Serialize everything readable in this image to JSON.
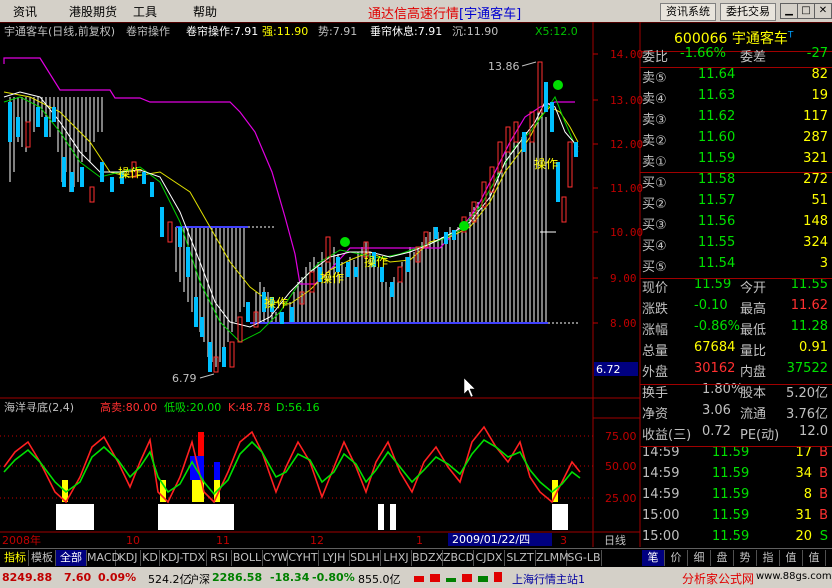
{
  "menu": [
    "资讯",
    "港股期货",
    "工具",
    "帮助"
  ],
  "app_title": "通达信高速行情",
  "app_subtitle": "[宇通客车]",
  "buttons": {
    "info_system": "资讯系统",
    "trade": "委托交易"
  },
  "chart": {
    "header": {
      "name": "宇通客车(日线,前复权)",
      "indicator": "卷帘操作",
      "ind1": "卷帘操作:7.91",
      "ind2": "强:11.90",
      "ind3": "势:7.91",
      "ind4": "垂帘休息:7.91",
      "ind5": "沉:11.90",
      "extra": "X5:12.0"
    },
    "y_ticks": [
      "14.00",
      "13.00",
      "12.00",
      "11.00",
      "10.00",
      "9.00",
      "8.00"
    ],
    "high_label": "13.86",
    "low_label": "6.79",
    "cursor_price": "6.72",
    "labels": [
      "操作",
      "操作",
      "操作",
      "操作",
      "操作"
    ]
  },
  "sub_chart": {
    "title": "海洋寻底(2,4)",
    "gaomai": "高卖:80.00",
    "dixi": "低吸:20.00",
    "k": "K:48.78",
    "d": "D:56.16",
    "y_ticks": [
      "75.00",
      "50.00",
      "25.00"
    ]
  },
  "x_axis": {
    "labels": [
      "2008年",
      "10",
      "11",
      "12",
      "1",
      "3"
    ],
    "cursor_date": "2009/01/22/四",
    "period": "日线"
  },
  "quote": {
    "code": "600066",
    "name": "宇通客车",
    "weibi_label": "委比",
    "weibi": "-1.66%",
    "weicha_label": "委差",
    "weicha": "-27",
    "sell": [
      {
        "label": "卖⑤",
        "price": "11.64",
        "vol": "82"
      },
      {
        "label": "卖④",
        "price": "11.63",
        "vol": "19"
      },
      {
        "label": "卖③",
        "price": "11.62",
        "vol": "117"
      },
      {
        "label": "卖②",
        "price": "11.60",
        "vol": "287"
      },
      {
        "label": "卖①",
        "price": "11.59",
        "vol": "321"
      }
    ],
    "buy": [
      {
        "label": "买①",
        "price": "11.58",
        "vol": "272"
      },
      {
        "label": "买②",
        "price": "11.57",
        "vol": "51"
      },
      {
        "label": "买③",
        "price": "11.56",
        "vol": "148"
      },
      {
        "label": "买④",
        "price": "11.55",
        "vol": "324"
      },
      {
        "label": "买⑤",
        "price": "11.54",
        "vol": "3"
      }
    ],
    "stats": [
      {
        "l1": "现价",
        "v1": "11.59",
        "l2": "今开",
        "v2": "11.55"
      },
      {
        "l1": "涨跌",
        "v1": "-0.10",
        "l2": "最高",
        "v2": "11.62"
      },
      {
        "l1": "涨幅",
        "v1": "-0.86%",
        "l2": "最低",
        "v2": "11.28"
      },
      {
        "l1": "总量",
        "v1": "67684",
        "l2": "量比",
        "v2": "0.91"
      },
      {
        "l1": "外盘",
        "v1": "30162",
        "l2": "内盘",
        "v2": "37522"
      }
    ],
    "stats2": [
      {
        "l1": "换手",
        "v1": "1.80%",
        "l2": "股本",
        "v2": "5.20亿"
      },
      {
        "l1": "净资",
        "v1": "3.06",
        "l2": "流通",
        "v2": "3.76亿"
      },
      {
        "l1": "收益(三)",
        "v1": "0.72",
        "l2": "PE(动)",
        "v2": "12.0"
      }
    ],
    "ticks": [
      {
        "t": "14:59",
        "p": "11.59",
        "v": "17",
        "s": "B"
      },
      {
        "t": "14:59",
        "p": "11.59",
        "v": "34",
        "s": "B"
      },
      {
        "t": "14:59",
        "p": "11.59",
        "v": "8",
        "s": "B"
      },
      {
        "t": "15:00",
        "p": "11.59",
        "v": "31",
        "s": "B"
      },
      {
        "t": "15:00",
        "p": "11.59",
        "v": "20",
        "s": "S"
      },
      {
        "t": "15:00",
        "p": "11.59",
        "v": "3",
        "s": ""
      }
    ]
  },
  "tabs": [
    "指标",
    "模板",
    "全部",
    "MACD",
    "KDJ",
    "KD",
    "KDJ-TDX",
    "RSI",
    "BOLL",
    "CYW",
    "CYHT",
    "LYJH",
    "SDLH",
    "LHXJ",
    "BDZX",
    "ZBCD",
    "CJDX",
    "SLZT",
    "ZLMM",
    "SG-LB"
  ],
  "right_tabs": [
    "笔",
    "价",
    "细",
    "盘",
    "势",
    "指",
    "值",
    "值"
  ],
  "status": {
    "index1": "8249.88",
    "chg1": "7.60",
    "pct1": "0.09%",
    "amt1": "524.2亿",
    "hs_label": "沪深",
    "index2": "2286.58",
    "chg2": "-18.34",
    "pct2": "-0.80%",
    "amt2": "855.0亿",
    "server": "上海行情主站1",
    "brand": "分析家公式网",
    "brand_url": "www.88gs.com"
  }
}
